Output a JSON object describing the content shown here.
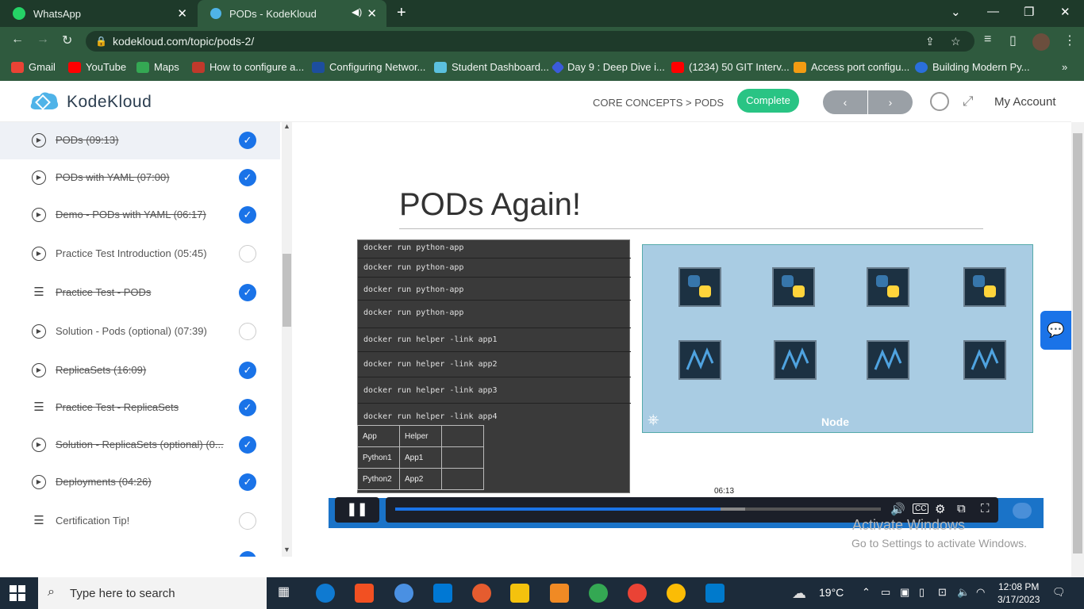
{
  "browser": {
    "tabs": [
      {
        "title": "WhatsApp"
      },
      {
        "title": "PODs - KodeKloud"
      }
    ],
    "url": "kodekloud.com/topic/pods-2/",
    "bookmarks": [
      "Gmail",
      "YouTube",
      "Maps",
      "How to configure a...",
      "Configuring Networ...",
      "Student Dashboard...",
      "Day 9 : Deep Dive i...",
      "(1234) 50 GIT Interv...",
      "Access port configu...",
      "Building Modern Py..."
    ]
  },
  "header": {
    "logo_text": "KodeKloud",
    "breadcrumb": "CORE CONCEPTS > PODS",
    "complete_label": "Complete",
    "prev_label": "‹",
    "next_label": "›",
    "account_label": "My Account"
  },
  "sidebar": {
    "items": [
      {
        "label": "PODs (09:13)",
        "icon": "play-icon",
        "done": true
      },
      {
        "label": "PODs with YAML (07:00)",
        "icon": "play-icon",
        "done": true
      },
      {
        "label": "Demo - PODs with YAML (06:17)",
        "icon": "play-icon",
        "done": true
      },
      {
        "label": "Practice Test Introduction (05:45)",
        "icon": "play-icon",
        "done": false
      },
      {
        "label": "Practice Test - PODs",
        "icon": "list-icon",
        "done": true
      },
      {
        "label": "Solution - Pods (optional) (07:39)",
        "icon": "play-icon",
        "done": false
      },
      {
        "label": "ReplicaSets (16:09)",
        "icon": "play-icon",
        "done": true
      },
      {
        "label": "Practice Test - ReplicaSets",
        "icon": "list-icon",
        "done": true
      },
      {
        "label": "Solution - ReplicaSets (optional) (0...",
        "icon": "play-icon",
        "done": true
      },
      {
        "label": "Deployments (04:26)",
        "icon": "play-icon",
        "done": true
      },
      {
        "label": "Certification Tip!",
        "icon": "list-icon",
        "done": false
      }
    ]
  },
  "video": {
    "slide_title": "PODs Again!",
    "commands": [
      "docker run python-app",
      "docker run python-app",
      "docker run python-app",
      "docker run python-app",
      "docker run helper -link app1",
      "docker run helper -link app2",
      "docker run helper -link app3",
      "docker run helper -link app4"
    ],
    "table": [
      [
        "App",
        "Helper",
        ""
      ],
      [
        "Python1",
        "App1",
        ""
      ],
      [
        "Python2",
        "App2",
        ""
      ]
    ],
    "node_label": "Node",
    "current_time": "06:13",
    "progress": 0.67,
    "buffered": 0.72
  },
  "watermark": {
    "line1": "Activate Windows",
    "line2": "Go to Settings to activate Windows."
  },
  "taskbar": {
    "search_placeholder": "Type here to search",
    "weather": "19°C",
    "time": "12:08 PM",
    "date": "3/17/2023"
  },
  "colors": {
    "accent": "#1a73e8",
    "complete": "#29c484",
    "browser_frame": "#2f5a3e"
  }
}
